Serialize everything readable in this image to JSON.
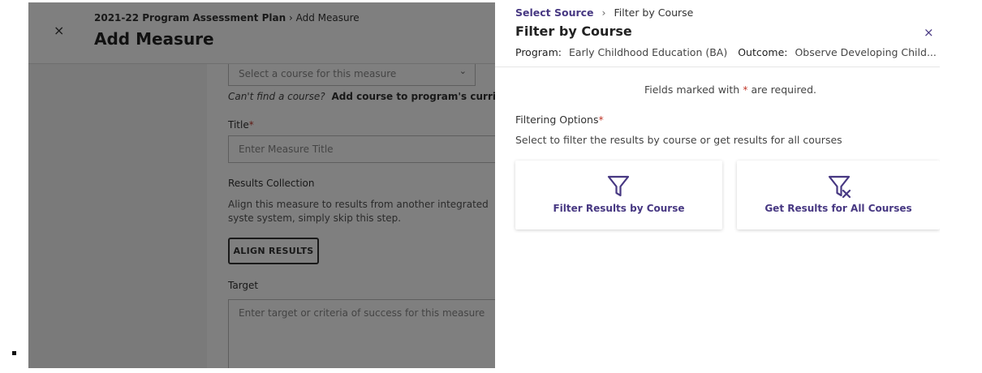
{
  "background": {
    "breadcrumb_parent": "2021-22 Program Assessment Plan",
    "breadcrumb_separator": "›",
    "breadcrumb_current": "Add Measure",
    "page_title": "Add Measure",
    "close_glyph": "×",
    "course_select": {
      "placeholder": "Select a course for this measure",
      "chevron": "⌄"
    },
    "cant_find_text": "Can't find a course?",
    "cant_find_link": "Add course to program's curriculum",
    "title_label": "Title",
    "required_star": "*",
    "title_placeholder": "Enter Measure Title",
    "results_collection_label": "Results Collection",
    "results_collection_desc": "Align this measure to results from another integrated syste system, simply skip this step.",
    "align_results_button": "ALIGN RESULTS",
    "target_label": "Target",
    "target_placeholder": "Enter target or criteria of success for this measure"
  },
  "drawer": {
    "breadcrumb_link": "Select Source",
    "breadcrumb_separator": "›",
    "breadcrumb_current": "Filter by Course",
    "title": "Filter by Course",
    "close_glyph": "×",
    "program_label": "Program:",
    "program_value": "Early Childhood Education (BA)",
    "outcome_label": "Outcome:",
    "outcome_value": "Observe Developing Child...",
    "required_note_before": "Fields marked with",
    "required_star": "*",
    "required_note_after": "are required.",
    "filtering_label": "Filtering Options",
    "filtering_desc": "Select to filter the results by course or get results for all courses",
    "options": [
      {
        "label": "Filter Results by Course",
        "icon": "filter-icon"
      },
      {
        "label": "Get Results for All Courses",
        "icon": "filter-clear-icon"
      }
    ]
  },
  "colors": {
    "accent": "#473882",
    "required": "#c0392b",
    "overlay": "rgba(0,0,0,0.5)"
  }
}
